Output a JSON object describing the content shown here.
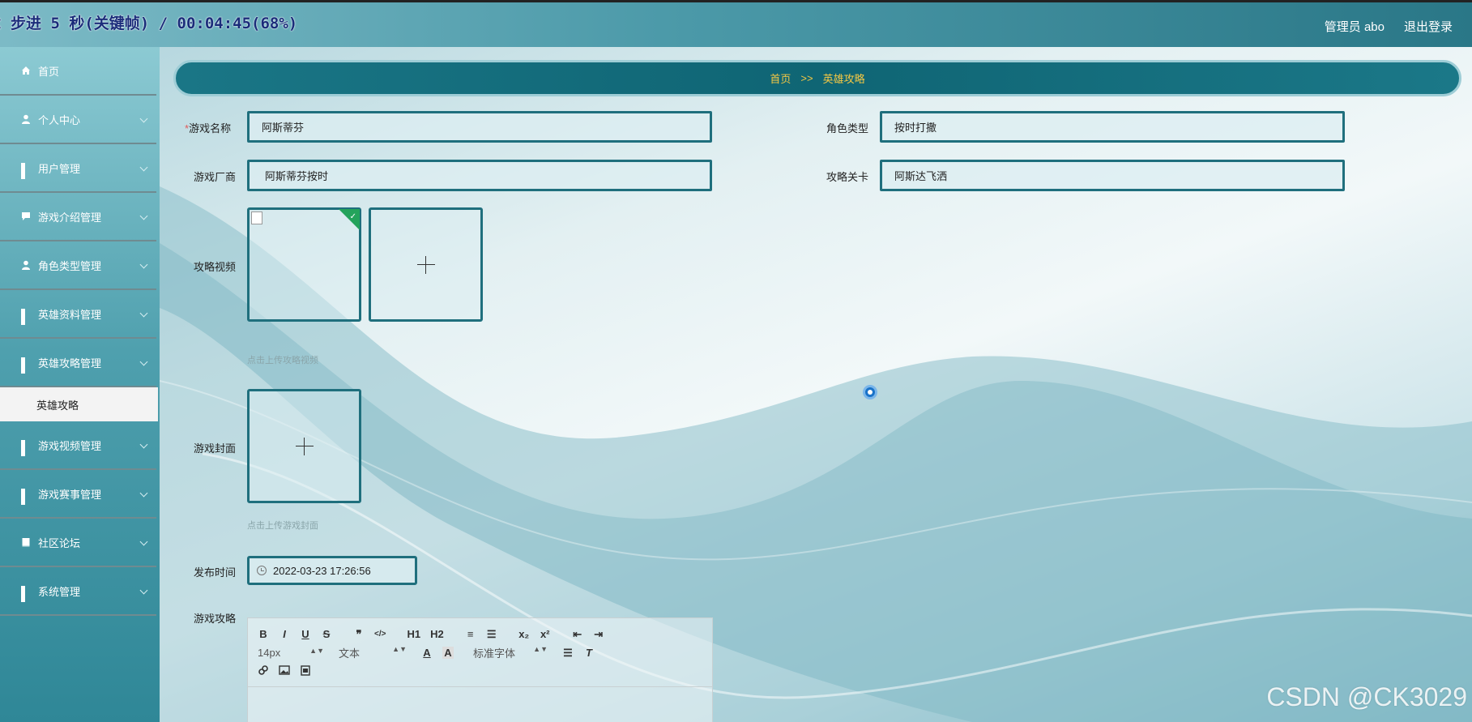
{
  "overlay_title": "：步进 5 秒(关键帧) / 00:04:45(68%)",
  "header": {
    "user_label": "管理员 abo",
    "logout_label": "退出登录"
  },
  "sidebar": {
    "items": [
      {
        "label": "首页",
        "icon": "home-icon"
      },
      {
        "label": "个人中心",
        "icon": "person-icon"
      },
      {
        "label": "用户管理",
        "icon": "grid-icon"
      },
      {
        "label": "游戏介绍管理",
        "icon": "chat-icon"
      },
      {
        "label": "角色类型管理",
        "icon": "person-icon"
      },
      {
        "label": "英雄资料管理",
        "icon": "grid-icon"
      },
      {
        "label": "英雄攻略管理",
        "icon": "grid-icon"
      },
      {
        "label": "游戏视频管理",
        "icon": "grid-icon"
      },
      {
        "label": "游戏赛事管理",
        "icon": "grid-icon"
      },
      {
        "label": "社区论坛",
        "icon": "book-icon"
      },
      {
        "label": "系统管理",
        "icon": "grid-icon"
      }
    ],
    "active_sub": "英雄攻略"
  },
  "breadcrumb": {
    "home": "首页",
    "separator": ">>",
    "current": "英雄攻略"
  },
  "form": {
    "required_mark": "*",
    "game_name_label": "游戏名称",
    "game_name_value": "阿斯蒂芬",
    "role_type_label": "角色类型",
    "role_type_value": "按时打撒",
    "vendor_label": "游戏厂商",
    "vendor_value": "阿斯蒂芬按时",
    "guide_level_label": "攻略关卡",
    "guide_level_value": "阿斯达飞洒",
    "video_label": "攻略视频",
    "video_hint": "点击上传攻略视频",
    "cover_label": "游戏封面",
    "cover_hint": "点击上传游戏封面",
    "publish_time_label": "发布时间",
    "publish_time_value": "2022-03-23 17:26:56",
    "guide_label": "游戏攻略"
  },
  "editor": {
    "row1": [
      "B",
      "I",
      "U",
      "S",
      "❞",
      "</>",
      "H1",
      "H2",
      "≡",
      "☰",
      "x₂",
      "x²",
      "⇤",
      "⇥"
    ],
    "font_size": "14px",
    "text_style": "文本",
    "font_family": "标准字体",
    "row3_icons": [
      "link-icon",
      "image-icon",
      "video-icon"
    ]
  },
  "watermark": "CSDN @CK3029"
}
